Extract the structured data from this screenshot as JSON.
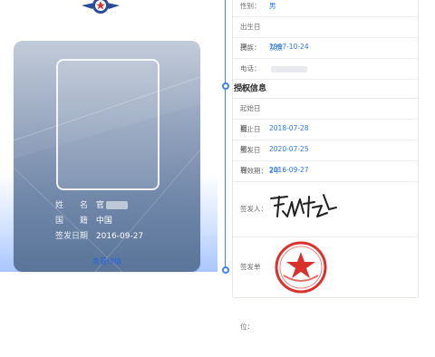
{
  "card": {
    "name_label": "姓　　名",
    "name_value": "官",
    "nation_label": "国　　籍",
    "nation_value": "中国",
    "issue_label": "签发日期",
    "issue_value": "2016-09-27",
    "details_link": "查看详情"
  },
  "personal": {
    "rows": [
      {
        "key": "性别：",
        "value": "男"
      },
      {
        "key": "出生日期：",
        "value": "1997-10-24"
      },
      {
        "key": "民族：",
        "value": "汉族"
      },
      {
        "key": "电话：",
        "value": ""
      },
      {
        "key": "地址：",
        "value": ""
      }
    ]
  },
  "auth": {
    "title": "授权信息",
    "rows": [
      {
        "key": "起始日期：",
        "value": "2018-07-28"
      },
      {
        "key": "截止日期：",
        "value": "2020-07-25"
      },
      {
        "key": "签发日期：",
        "value": "2016-09-27"
      },
      {
        "key": "有效期：",
        "value": "2年"
      }
    ],
    "signer_label": "签发人：",
    "unit_label": "签发单位："
  },
  "colors": {
    "accent": "#3f82f6",
    "value_text": "#2b78e4",
    "card_top": "#bfc8d6",
    "card_bottom": "#5a7599",
    "stamp_red": "#d9312b"
  },
  "icons": [
    "emblem-icon",
    "signature-image",
    "official-seal-icon"
  ]
}
